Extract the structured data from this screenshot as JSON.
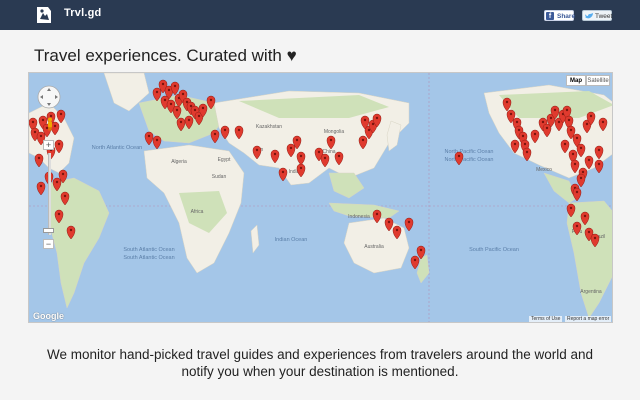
{
  "header": {
    "brand": "Trvl.gd",
    "share_facebook": "Share",
    "share_twitter": "Tweet"
  },
  "headline": "Travel experiences. Curated with ♥",
  "map": {
    "type_map": "Map",
    "type_satellite": "Satellite",
    "zoom_in": "+",
    "zoom_out": "−",
    "google": "Google",
    "terms": "Terms of Use",
    "report": "Report a map error",
    "labels": [
      {
        "text": "North Atlantic Ocean"
      },
      {
        "text": "North Pacific Ocean"
      },
      {
        "text": "North Pacific Ocean"
      },
      {
        "text": "South Atlantic Ocean"
      },
      {
        "text": "South Atlantic Ocean"
      },
      {
        "text": "Indian Ocean"
      },
      {
        "text": "South Pacific Ocean"
      },
      {
        "text": "Africa"
      },
      {
        "text": "Australia"
      },
      {
        "text": "Kazakhstan"
      },
      {
        "text": "China"
      },
      {
        "text": "India"
      },
      {
        "text": "Mongolia"
      },
      {
        "text": "Argentina"
      },
      {
        "text": "Brazil"
      },
      {
        "text": "Peru"
      },
      {
        "text": "Mexico"
      },
      {
        "text": "Sudan"
      },
      {
        "text": "Algeria"
      },
      {
        "text": "Egypt"
      },
      {
        "text": "Iran"
      },
      {
        "text": "Indonesia"
      }
    ],
    "pin_color": "#e03a2e",
    "pin_count": 104
  },
  "tagline": "We monitor hand-picked travel guides and experiences from travelers around the world and notify you when your destination is mentioned.",
  "colors": {
    "topbar": "#2a3a52",
    "water": "#a4c6e8",
    "land": "#f2efe6",
    "forest": "#cfe1b9",
    "pin": "#e03a2e"
  }
}
